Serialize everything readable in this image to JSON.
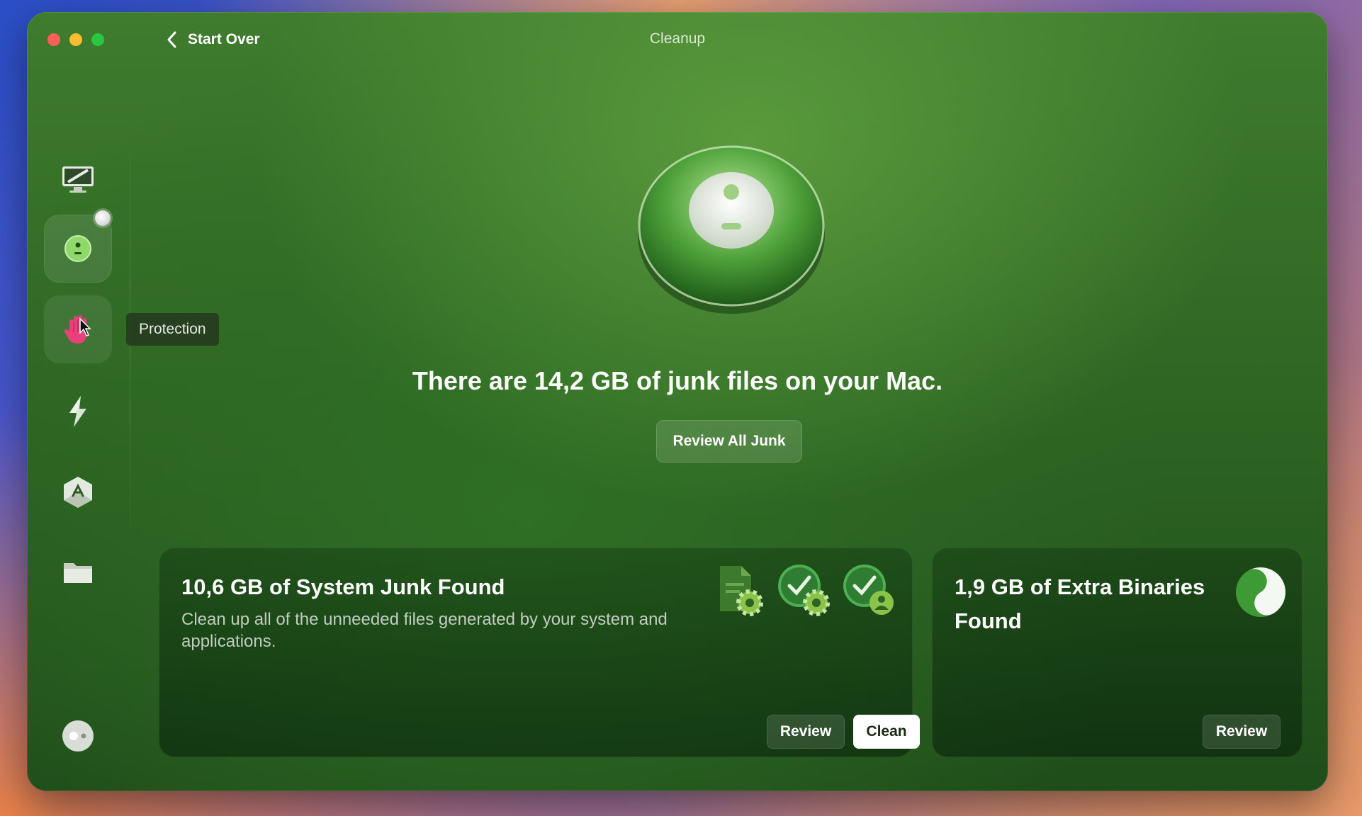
{
  "window": {
    "title": "Cleanup",
    "back_label": "Start Over"
  },
  "sidebar": {
    "items": [
      {
        "name": "smart-care",
        "icon": "monitor-sweep-icon"
      },
      {
        "name": "cleanup",
        "icon": "cleanup-orb-icon",
        "selected": true
      },
      {
        "name": "protection",
        "icon": "hand-icon"
      },
      {
        "name": "performance",
        "icon": "lightning-icon"
      },
      {
        "name": "applications",
        "icon": "app-store-icon"
      },
      {
        "name": "my-clutter",
        "icon": "folder-icon"
      }
    ],
    "tooltip": "Protection",
    "assistant_icon": "assistant-orb-icon"
  },
  "main": {
    "headline": "There are 14,2 GB of junk files on your Mac.",
    "review_all_label": "Review All Junk"
  },
  "cards": [
    {
      "title": "10,6 GB of System Junk Found",
      "description": "Clean up all of the unneeded files generated by your system and applications.",
      "icons": [
        "document-gear-icon",
        "clock-gear-icon",
        "clock-user-icon"
      ],
      "review_label": "Review",
      "clean_label": "Clean"
    },
    {
      "title": "1,9 GB of Extra Binaries Found",
      "icon": "binaries-icon",
      "review_label": "Review"
    }
  ],
  "colors": {
    "accent_green": "#5fbf3d",
    "hand_pink": "#e8407a"
  }
}
